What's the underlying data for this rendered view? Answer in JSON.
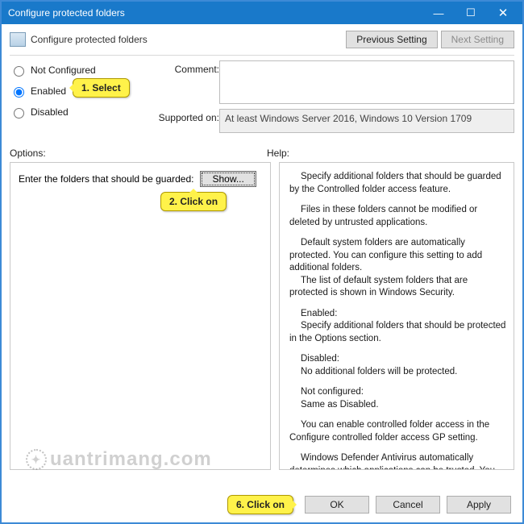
{
  "titlebar": {
    "title": "Configure protected folders"
  },
  "header": {
    "setting_title": "Configure protected folders",
    "prev_btn": "Previous Setting",
    "next_btn": "Next Setting"
  },
  "radios": {
    "not_configured": "Not Configured",
    "enabled": "Enabled",
    "disabled": "Disabled",
    "selected": "enabled"
  },
  "labels": {
    "comment": "Comment:",
    "supported_on": "Supported on:",
    "options": "Options:",
    "help": "Help:"
  },
  "supported_text": "At least Windows Server 2016, Windows 10 Version 1709",
  "options": {
    "prompt": "Enter the folders that should be guarded:",
    "show_btn": "Show..."
  },
  "help": {
    "p1": "Specify additional folders that should be guarded by the Controlled folder access feature.",
    "p2": "Files in these folders cannot be modified or deleted by untrusted applications.",
    "p3": "Default system folders are automatically protected. You can configure this setting to add additional folders.",
    "p3b": "The list of default system folders that are protected is shown in Windows Security.",
    "p4a": "Enabled:",
    "p4b": "Specify additional folders that should be protected in the Options section.",
    "p5a": "Disabled:",
    "p5b": "No additional folders will be protected.",
    "p6a": "Not configured:",
    "p6b": "Same as Disabled.",
    "p7": "You can enable controlled folder access in the Configure controlled folder access GP setting.",
    "p8": "Windows Defender Antivirus automatically determines which applications can be trusted. You can add additional trusted applications in the Configure allowed applications GP setting."
  },
  "footer": {
    "ok": "OK",
    "cancel": "Cancel",
    "apply": "Apply"
  },
  "callouts": {
    "c1": "1. Select",
    "c2": "2. Click on",
    "c6": "6. Click on"
  },
  "watermark": "uantrimang.com"
}
